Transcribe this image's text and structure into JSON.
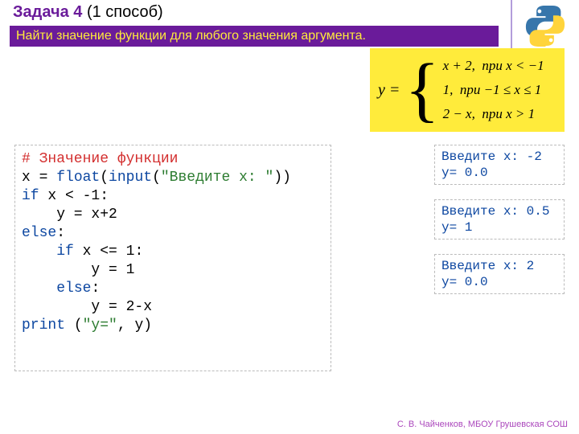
{
  "title": {
    "main": "Задача 4",
    "sub": " (1 способ)"
  },
  "banner": "Найти значение функции для любого значения аргумента.",
  "formula": {
    "lhs": "y =",
    "cases": [
      {
        "expr": "x + 2,",
        "cond": "при x < −1"
      },
      {
        "expr": "1,",
        "cond": "при −1 ≤ x ≤ 1"
      },
      {
        "expr": "2 − x,",
        "cond": "при x > 1"
      }
    ]
  },
  "code": {
    "l1": "# Значение функции",
    "l2a": "x = ",
    "l2b": "float",
    "l2c": "(",
    "l2d": "input",
    "l2e": "(",
    "l2f": "\"Введите x: \"",
    "l2g": "))",
    "l3a": "if",
    "l3b": " x < -1:",
    "l4": "    y = x+2",
    "l5": "else",
    "l5b": ":",
    "l6a": "    ",
    "l6b": "if",
    "l6c": " x <= 1:",
    "l7": "        y = 1",
    "l8a": "    ",
    "l8b": "else",
    "l8c": ":",
    "l9": "        y = 2-x",
    "l10a": "print",
    "l10b": " (",
    "l10c": "\"y=\"",
    "l10d": ", y)"
  },
  "outputs": [
    {
      "l1": "Введите x: -2",
      "l2": "y= 0.0"
    },
    {
      "l1": "Введите x: 0.5",
      "l2": "y= 1"
    },
    {
      "l1": "Введите x: 2",
      "l2": "y= 0.0"
    }
  ],
  "footer": "С. В. Чайченков, МБОУ Грушевская СОШ"
}
